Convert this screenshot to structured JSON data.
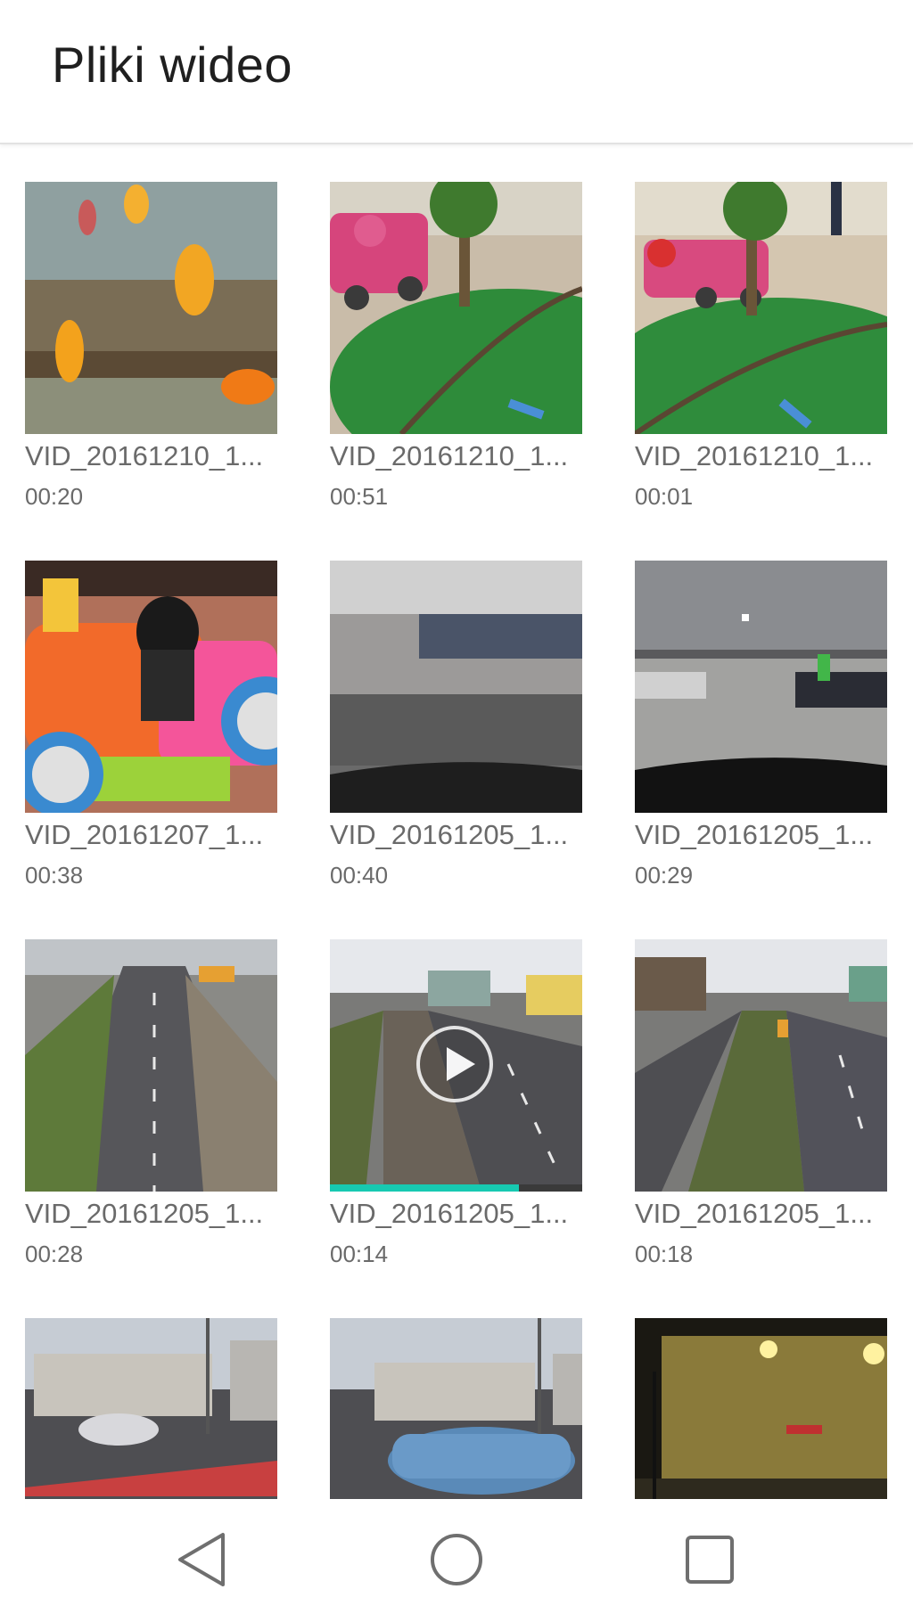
{
  "header": {
    "title": "Pliki wideo"
  },
  "videos": [
    {
      "name": "VID_20161210_1...",
      "duration": "00:20",
      "scene": "aquarium-goldfish"
    },
    {
      "name": "VID_20161210_1...",
      "duration": "00:51",
      "scene": "mall-toy-train"
    },
    {
      "name": "VID_20161210_1...",
      "duration": "00:01",
      "scene": "mall-toy-train"
    },
    {
      "name": "VID_20161207_1...",
      "duration": "00:38",
      "scene": "kiddie-ride-car"
    },
    {
      "name": "VID_20161205_1...",
      "duration": "00:40",
      "scene": "car-interior-garage"
    },
    {
      "name": "VID_20161205_1...",
      "duration": "00:29",
      "scene": "parking-garage"
    },
    {
      "name": "VID_20161205_1...",
      "duration": "00:28",
      "scene": "road-tram-tracks"
    },
    {
      "name": "VID_20161205_1...",
      "duration": "00:14",
      "scene": "road-tram-tracks",
      "playing": true,
      "progress": 0.75
    },
    {
      "name": "VID_20161205_1...",
      "duration": "00:18",
      "scene": "road-tram-tracks"
    },
    {
      "name": "",
      "duration": "",
      "scene": "street-buildings"
    },
    {
      "name": "",
      "duration": "",
      "scene": "street-buildings-car"
    },
    {
      "name": "",
      "duration": "",
      "scene": "night-street"
    }
  ],
  "navigation": {
    "back_icon": "triangle-back-icon",
    "home_icon": "circle-home-icon",
    "recents_icon": "square-recents-icon"
  },
  "colors": {
    "progress": "#17c9b1",
    "text": "#6a6a6a",
    "title": "#1f1f1f"
  }
}
